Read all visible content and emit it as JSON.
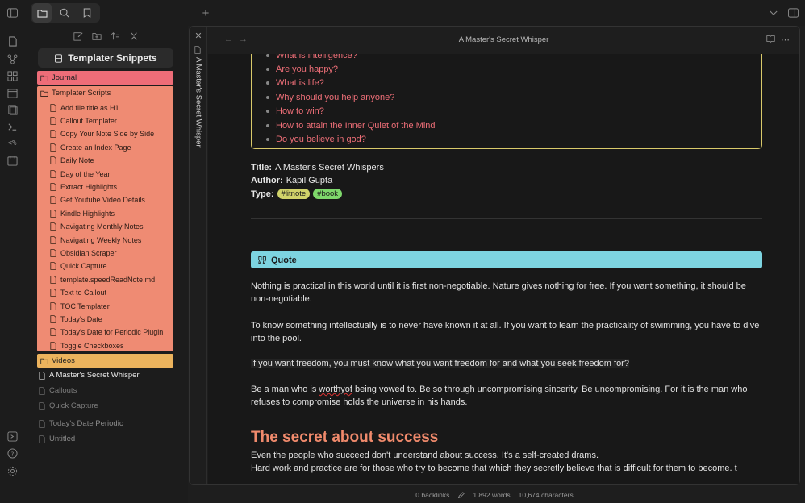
{
  "window": {
    "title": "A Master's Secret Whisper"
  },
  "sidebar": {
    "vault_name": "Templater Snippets",
    "journal_label": "Journal",
    "scripts_label": "Templater Scripts",
    "scripts": [
      "Add file title as H1",
      "Callout Templater",
      "Copy Your Note Side by Side",
      "Create an Index Page",
      "Daily Note",
      "Day of the Year",
      "Extract Highlights",
      "Get Youtube Video Details",
      "Kindle Highlights",
      "Navigating Monthly Notes",
      "Navigating Weekly Notes",
      "Obsidian Scraper",
      "Quick Capture",
      "template.speedReadNote.md",
      "Text to Callout",
      "TOC Templater",
      "Today's Date",
      "Today's Date for Periodic Plugin",
      "Toggle Checkboxes"
    ],
    "videos_label": "Videos",
    "files": [
      "A Master's Secret Whisper",
      "Callouts",
      "Quick Capture",
      "Today's Date Periodic",
      "Untitled"
    ]
  },
  "note": {
    "questions": [
      "What is intelligence?",
      "Are you happy?",
      "What is life?",
      "Why should you help anyone?",
      "How to win?",
      "How to attain the Inner Quiet of the Mind",
      "Do you believe in god?"
    ],
    "title_label": "Title:",
    "title_value": "A Master's Secret Whispers",
    "author_label": "Author:",
    "author_value": "Kapil Gupta",
    "type_label": "Type:",
    "tags": [
      "#litnote",
      "#book"
    ],
    "callout_title": "Quote",
    "p1": "Nothing is practical in this world until it is first non-negotiable. Nature gives nothing for free. If you want something, it should be non-negotiable.",
    "p2": "To know something intellectually is to never have known it at all. If you want to learn the practicality of swimming, you have to dive into the pool.",
    "p3": "If you want freedom, you must know what you want freedom for and what you seek freedom for?",
    "p4_a": "Be a man who is ",
    "p4_b": "worthyof",
    "p4_c": " being vowed to. Be so through uncompromising sincerity. Be uncompromising. For it is the man who refuses to compromise holds the universe in his hands.",
    "heading": "The secret about success",
    "p5": "Even the people who succeed don't understand about success. It's a self-created drams.",
    "p6": "Hard work and practice are for those who try to become that which they secretly believe that is difficult for them to become. t"
  },
  "status": {
    "backlinks": "0 backlinks",
    "words": "1,892 words",
    "characters": "10,674 characters"
  },
  "colors": {
    "journal": "#ee6d78",
    "scripts": "#ef8b73",
    "videos": "#ecb35d",
    "callout": "#7dd4e0",
    "heading": "#f08a6c"
  }
}
